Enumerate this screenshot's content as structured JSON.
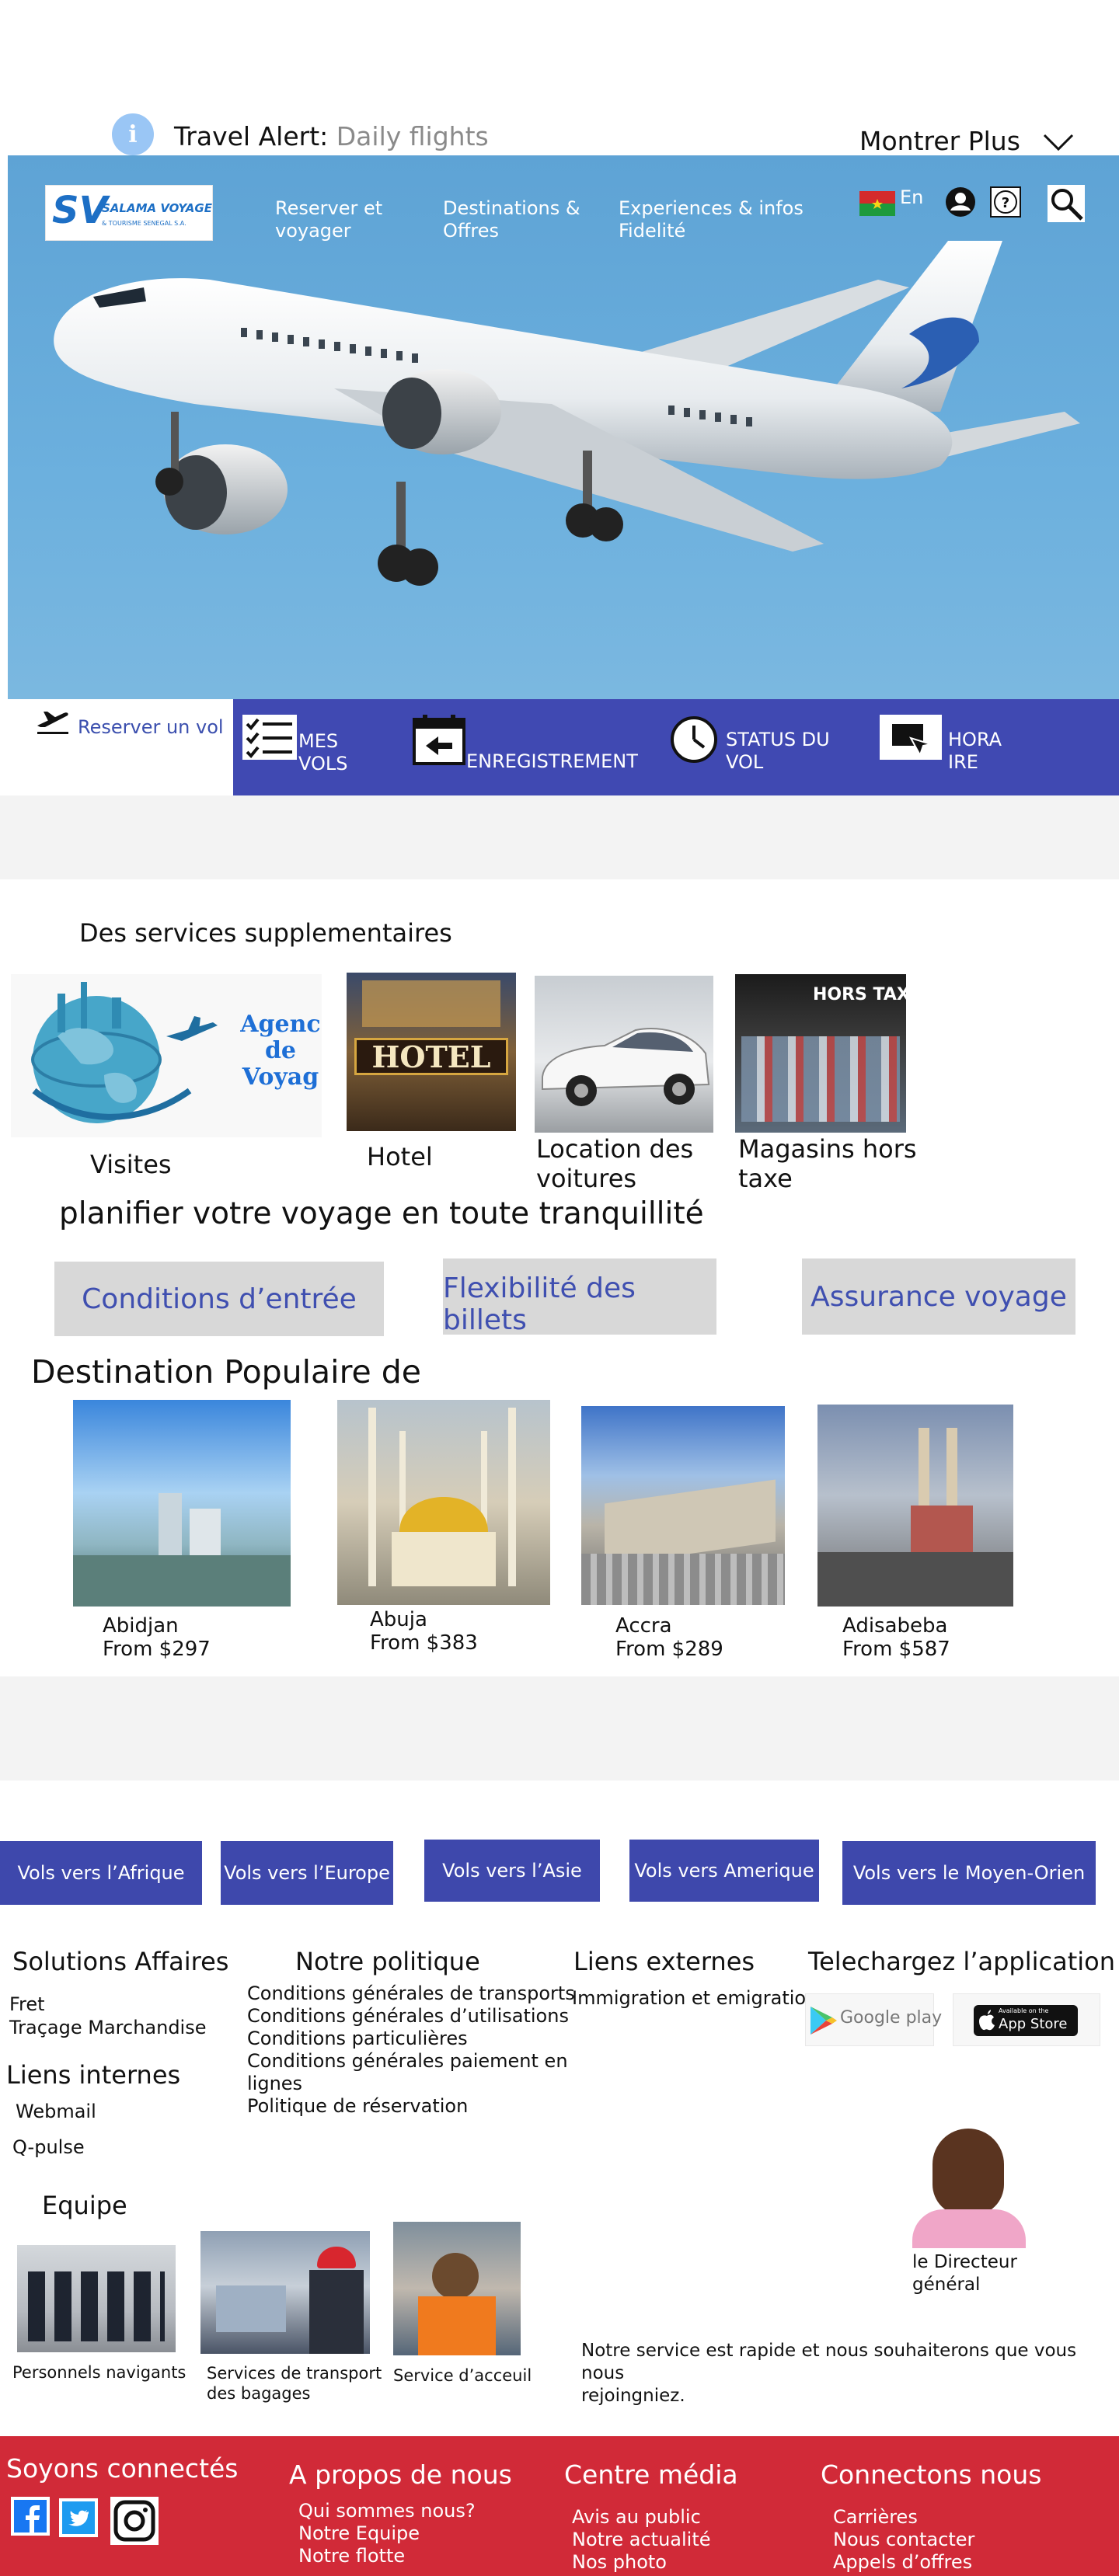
{
  "alert": {
    "label": "Travel Alert:",
    "text": "Daily flights",
    "more": "Montrer Plus"
  },
  "brand": {
    "logo_mark": "SV",
    "logo_name": "SALAMA VOYAGE",
    "logo_tagline": "& TOURISME SENEGAL S.A."
  },
  "nav": {
    "items": [
      {
        "line1": "Reserver et",
        "line2": "voyager"
      },
      {
        "line1": "Destinations &",
        "line2": "Offres"
      },
      {
        "line1": "Experiences & infos",
        "line2": "Fidelité"
      }
    ],
    "lang": "En"
  },
  "booking": {
    "book_link": "Reserver un vol",
    "tabs": [
      {
        "line1": "MES",
        "line2": "VOLS"
      },
      {
        "line1": "ENREGISTREMENT",
        "line2": ""
      },
      {
        "line1": "STATUS DU",
        "line2": "VOL"
      },
      {
        "line1": "HORA",
        "line2": "IRE"
      }
    ]
  },
  "services": {
    "title": "Des services supplementaires",
    "agency_text": [
      "Agenc",
      "de",
      "Voyag"
    ],
    "hotel_sign": "HOTEL",
    "duty_sign": "HORS TAXES",
    "items": [
      {
        "line1": "Visites",
        "line2": ""
      },
      {
        "line1": "Hotel",
        "line2": ""
      },
      {
        "line1": "Location des",
        "line2": "voitures"
      },
      {
        "line1": "Magasins hors",
        "line2": "taxe"
      }
    ]
  },
  "plan": {
    "title": "planifier votre voyage en toute tranquillité",
    "options": [
      "Conditions d’entrée",
      "Flexibilité des billets",
      "Assurance voyage"
    ]
  },
  "destinations": {
    "title": "Destination Populaire de",
    "items": [
      {
        "city": "Abidjan",
        "price": "From $297"
      },
      {
        "city": "Abuja",
        "price": "From $383"
      },
      {
        "city": "Accra",
        "price": "From $289"
      },
      {
        "city": "Adisabeba",
        "price": "From $587"
      }
    ]
  },
  "routes": [
    "Vols vers l’Afrique",
    "Vols vers l’Europe",
    "Vols vers l’Asie",
    "Vols vers Amerique",
    "Vols vers le Moyen-Orien"
  ],
  "footer_links": {
    "business": {
      "title": "Solutions Affaires",
      "items": [
        "Fret",
        "Traçage Marchandise"
      ]
    },
    "policy": {
      "title": "Notre politique",
      "items": [
        "Conditions générales de transports",
        "Conditions générales d’utilisations",
        "Conditions particulières",
        "Conditions générales paiement en",
        "lignes",
        "Politique de réservation"
      ]
    },
    "external": {
      "title": "Liens externes",
      "items": [
        "Immigration et emigration"
      ]
    },
    "app": {
      "title": "Telechargez l’application",
      "google": "Google play",
      "apple_small": "Available on the",
      "apple": "App Store"
    },
    "internal": {
      "title": "Liens internes",
      "items": [
        "Webmail",
        "Q-pulse"
      ]
    }
  },
  "team": {
    "title": "Equipe",
    "members": [
      {
        "line1": "Personnels navigants",
        "line2": ""
      },
      {
        "line1": "Services de transport",
        "line2": "des bagages"
      },
      {
        "line1": "Service d’acceuil",
        "line2": ""
      }
    ],
    "director": {
      "line1": "le Directeur",
      "line2": "général"
    },
    "message_line1": "Notre service est rapide et nous souhaiterons que vous nous",
    "message_line2": "rejoingniez."
  },
  "footer": {
    "social_title": "Soyons connectés",
    "about": {
      "title": "A propos de nous",
      "items": [
        "Qui sommes nous?",
        "Notre Equipe",
        "Notre flotte"
      ]
    },
    "media": {
      "title": "Centre média",
      "items": [
        "Avis au public",
        "Notre actualité",
        "Nos photo"
      ]
    },
    "connect": {
      "title": "Connectons nous",
      "items": [
        "Carrières",
        "Nous contacter",
        "Appels d’offres"
      ]
    }
  },
  "colors": {
    "primary": "#4049b2",
    "hero_sky": "#6cb0de",
    "footer_red": "#d12a38",
    "pill_grey": "#d8d8d8",
    "link_blue": "#3b4fae"
  }
}
